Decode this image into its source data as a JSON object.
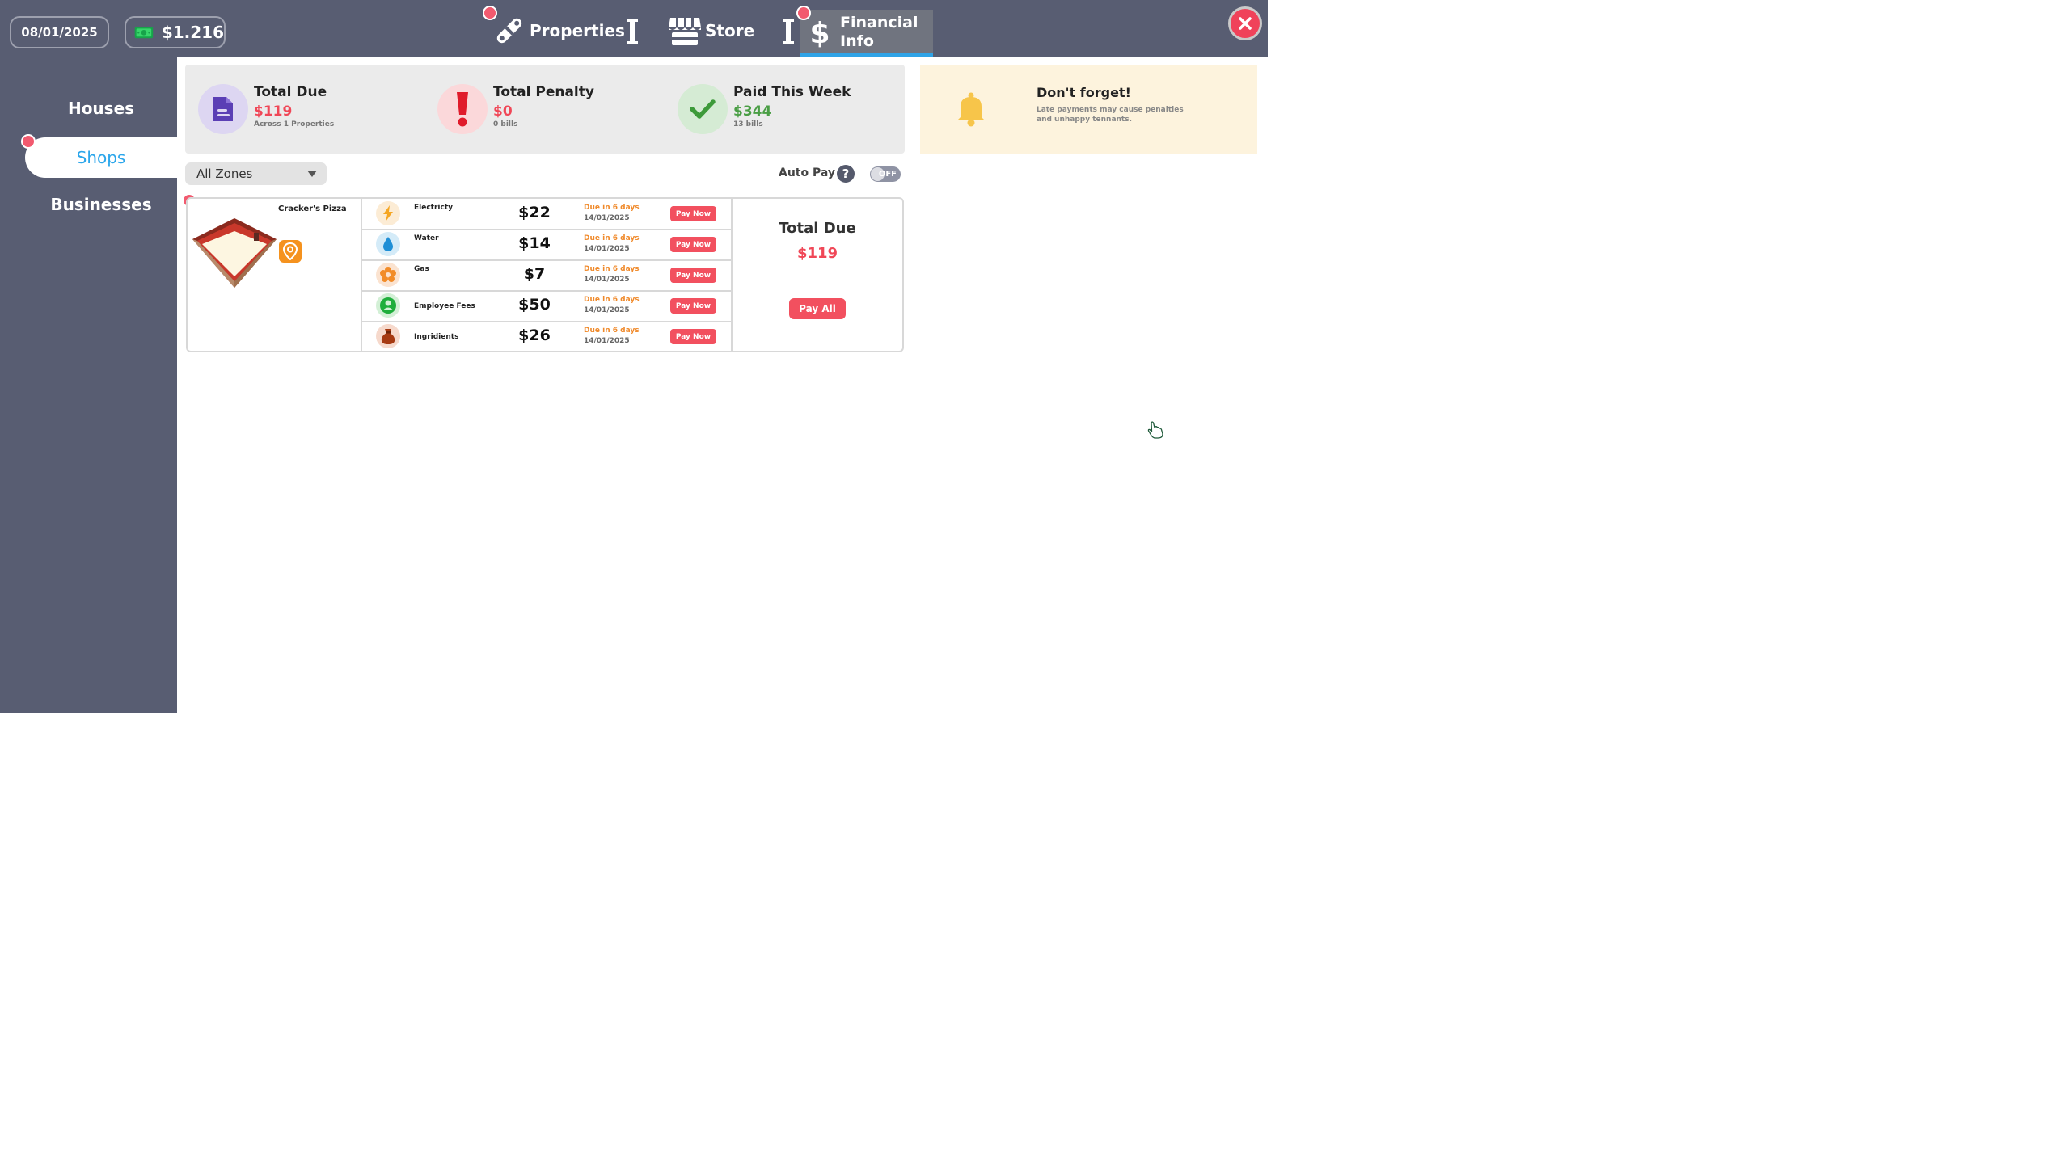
{
  "header": {
    "date": "08/01/2025",
    "money": "$1.216",
    "nav": [
      {
        "label": "Properties",
        "icon": "scroll-icon",
        "notification": true
      },
      {
        "label": "Store",
        "icon": "store-icon",
        "notification": false
      },
      {
        "label": "Financial Info",
        "label_line1": "Financial",
        "label_line2": "Info",
        "icon": "dollar-icon",
        "notification": true,
        "active": true
      }
    ]
  },
  "sidebar": {
    "items": [
      {
        "label": "Houses",
        "active": false
      },
      {
        "label": "Shops",
        "active": true,
        "notification": true
      },
      {
        "label": "Businesses",
        "active": false
      }
    ]
  },
  "summary": {
    "total_due": {
      "title": "Total Due",
      "value": "$119",
      "sub": "Across 1 Properties",
      "icon": "document-icon"
    },
    "total_penalty": {
      "title": "Total Penalty",
      "value": "$0",
      "sub": "0 bills",
      "icon": "exclamation-icon"
    },
    "paid_week": {
      "title": "Paid This Week",
      "value": "$344",
      "sub": "13 bills",
      "icon": "checkmark-icon"
    }
  },
  "reminder": {
    "title": "Don't forget!",
    "text": "Late payments may cause penalties and unhappy tennants.",
    "icon": "bell-icon"
  },
  "filters": {
    "zone": "All Zones",
    "autopay_label": "Auto Pay",
    "autopay_state": "OFF"
  },
  "property": {
    "name": "Cracker's Pizza",
    "bills": [
      {
        "name": "Electricty",
        "amount": "$22",
        "due": "Due in 6 days",
        "date": "14/01/2025",
        "button": "Pay Now",
        "icon": "lightning-icon"
      },
      {
        "name": "Water",
        "amount": "$14",
        "due": "Due in 6 days",
        "date": "14/01/2025",
        "button": "Pay Now",
        "icon": "water-drop-icon"
      },
      {
        "name": "Gas",
        "amount": "$7",
        "due": "Due in 6 days",
        "date": "14/01/2025",
        "button": "Pay Now",
        "icon": "flower-icon"
      },
      {
        "name": "Employee Fees",
        "amount": "$50",
        "due": "Due in 6 days",
        "date": "14/01/2025",
        "button": "Pay Now",
        "icon": "person-icon"
      },
      {
        "name": "Ingridients",
        "amount": "$26",
        "due": "Due in 6 days",
        "date": "14/01/2025",
        "button": "Pay Now",
        "icon": "sack-icon"
      }
    ],
    "total_title": "Total Due",
    "total_value": "$119",
    "pay_all": "Pay All"
  },
  "colors": {
    "panel": "#585d72",
    "accent_blue": "#2ba6eb",
    "due_red": "#f04757",
    "paid_green": "#4a9e45",
    "due_orange": "#f08a2b"
  }
}
